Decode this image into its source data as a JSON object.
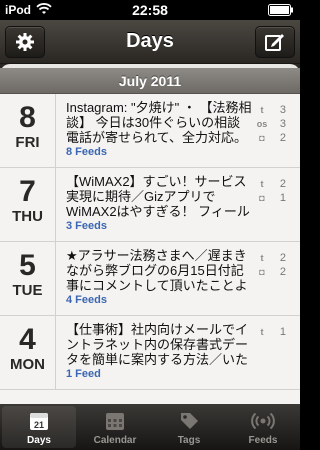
{
  "status": {
    "carrier": "iPod",
    "time": "22:58"
  },
  "nav": {
    "title": "Days",
    "settings_icon": "gear-icon",
    "compose_icon": "compose-icon"
  },
  "section": {
    "title": "July 2011"
  },
  "rows": [
    {
      "day": "8",
      "weekday": "FRI",
      "text": "Instagram: \"夕焼け\" ・ 【法務相談】 今日は30件ぐらいの相談電話が寄せられて、全力対応。そのジャンル...",
      "feeds": "8 Feeds",
      "stats": [
        {
          "icon": "twitter-icon",
          "glyph": "t",
          "count": "3"
        },
        {
          "icon": "os-icon",
          "glyph": "os",
          "count": "3"
        },
        {
          "icon": "camera-icon",
          "glyph": "◘",
          "count": "2"
        }
      ]
    },
    {
      "day": "7",
      "weekday": "THU",
      "text": "【WiMAX2】すごい！サービス実現に期待／GizアプリでWiMAX2はやすぎる！ フィールドテストで...",
      "feeds": "3 Feeds",
      "stats": [
        {
          "icon": "twitter-icon",
          "glyph": "t",
          "count": "2"
        },
        {
          "icon": "camera-icon",
          "glyph": "◘",
          "count": "1"
        }
      ]
    },
    {
      "day": "5",
      "weekday": "TUE",
      "text": "★アラサー法務さまへ／遅まきながら弊ブログの6月15日付記事にコメントして頂いたことようやく気...",
      "feeds": "4 Feeds",
      "stats": [
        {
          "icon": "twitter-icon",
          "glyph": "t",
          "count": "2"
        },
        {
          "icon": "camera-icon",
          "glyph": "◘",
          "count": "2"
        }
      ]
    },
    {
      "day": "4",
      "weekday": "MON",
      "text": "【仕事術】社内向けメールでイントラネット内の保存書式データを簡単に案内する方法／いたってシンプ...",
      "feeds": "1 Feed",
      "stats": [
        {
          "icon": "twitter-icon",
          "glyph": "t",
          "count": "1"
        }
      ]
    }
  ],
  "tabs": [
    {
      "label": "Days",
      "icon": "calendar-day-icon",
      "badge": "21",
      "active": true
    },
    {
      "label": "Calendar",
      "icon": "calendar-grid-icon",
      "active": false
    },
    {
      "label": "Tags",
      "icon": "tag-icon",
      "active": false
    },
    {
      "label": "Feeds",
      "icon": "feeds-icon",
      "active": false
    }
  ]
}
